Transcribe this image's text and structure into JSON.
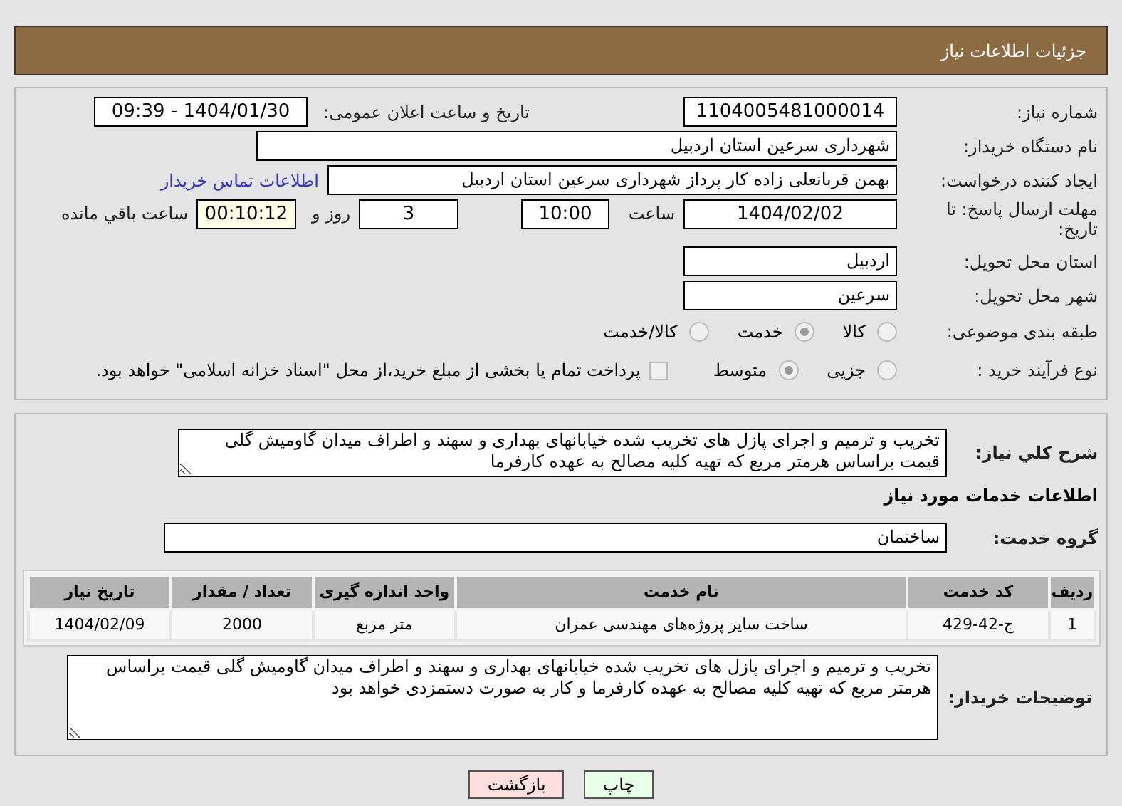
{
  "header": {
    "title": "جزئیات اطلاعات نیاز"
  },
  "details": {
    "need_number": {
      "label": "شماره نیاز:",
      "value": "1104005481000014"
    },
    "announce": {
      "label": "تاریخ و ساعت اعلان عمومی:",
      "value": "1404/01/30 - 09:39"
    },
    "buyer": {
      "label": "نام دستگاه خریدار:",
      "value": "شهرداری سرعین استان اردبیل"
    },
    "creator": {
      "label": "ایجاد کننده درخواست:",
      "value": "بهمن قربانعلی زاده کار پرداز شهرداری سرعین استان اردبیل",
      "link": "اطلاعات تماس خریدار"
    },
    "deadline": {
      "label": "مهلت ارسال پاسخ: تا تاریخ:",
      "date": "1404/02/02",
      "time_label": "ساعت",
      "time": "10:00",
      "days": "3",
      "days_label": "روز و",
      "remaining": "00:10:12",
      "remaining_label": "ساعت باقي مانده"
    },
    "province": {
      "label": "استان محل تحویل:",
      "value": "اردبیل"
    },
    "city": {
      "label": "شهر محل تحویل:",
      "value": "سرعین"
    },
    "category": {
      "label": "طبقه بندی موضوعی:",
      "options": [
        {
          "label": "کالا",
          "selected": false
        },
        {
          "label": "خدمت",
          "selected": true
        },
        {
          "label": "کالا/خدمت",
          "selected": false
        }
      ]
    },
    "process": {
      "label": "نوع فرآیند خرید :",
      "options": [
        {
          "label": "جزیی",
          "selected": false
        },
        {
          "label": "متوسط",
          "selected": true
        }
      ],
      "payment": {
        "checked": false,
        "text": "پرداخت تمام یا بخشی از مبلغ خرید،از محل \"اسناد خزانه اسلامی\" خواهد بود."
      }
    }
  },
  "services": {
    "description_label": "شرح کلي نياز:",
    "description": "تخریب و ترمیم و اجرای پازل های تخریب شده خیابانهای بهداری و سهند و اطراف میدان گاومیش گلی قیمت براساس هرمتر مربع که تهیه کلیه مصالح به عهده کارفرما",
    "heading": "اطلاعات خدمات مورد نیاز",
    "group_label": "گروه خدمت:",
    "group": "ساختمان",
    "table": {
      "columns": [
        "ردیف",
        "کد خدمت",
        "نام خدمت",
        "واحد اندازه گیری",
        "تعداد / مقدار",
        "تاریخ نیاز"
      ],
      "rows": [
        [
          "1",
          "ج-42-429",
          "ساخت سایر پروژه‌های مهندسی عمران",
          "متر مربع",
          "2000",
          "1404/02/09"
        ]
      ]
    },
    "notes_label": "توضیحات خریدار:",
    "notes": "تخریب و ترمیم و اجرای پازل های تخریب شده خیابانهای بهداری و سهند و اطراف میدان گاومیش گلی قیمت براساس هرمتر مربع که تهیه کلیه مصالح به عهده کارفرما و کار به صورت دستمزدی خواهد بود"
  },
  "buttons": [
    {
      "label": "چاپ",
      "kind": "print"
    },
    {
      "label": "بازگشت",
      "kind": "back"
    }
  ]
}
